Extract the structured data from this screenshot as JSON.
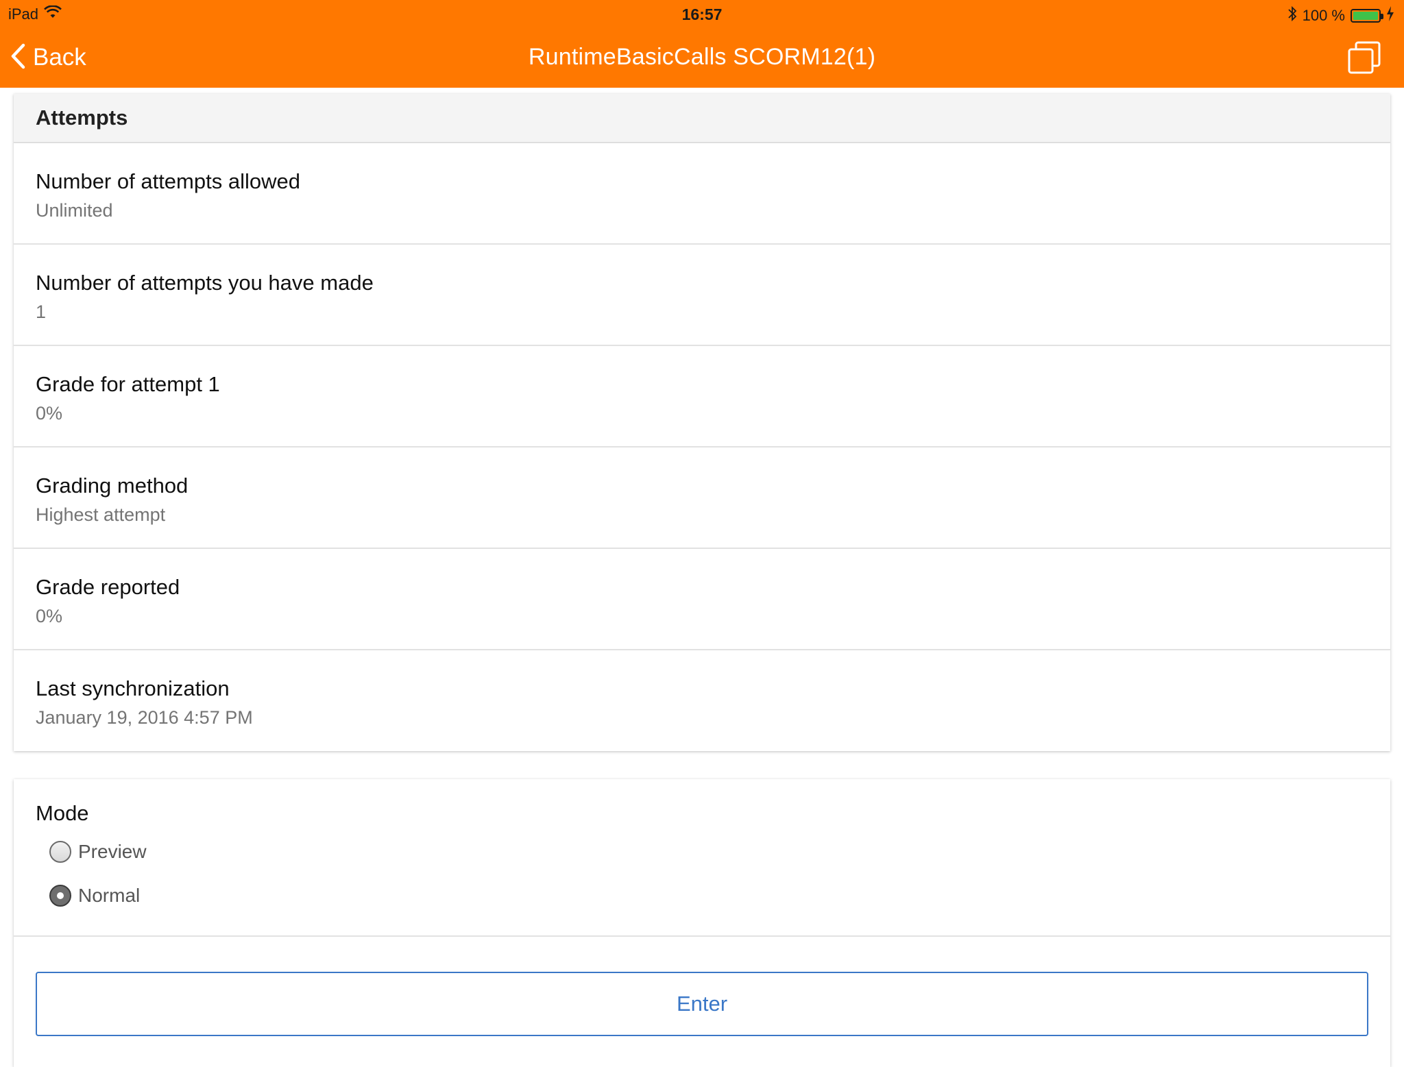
{
  "status_bar": {
    "device": "iPad",
    "time": "16:57",
    "battery_text": "100 %",
    "battery_level": 1.0,
    "icons": [
      "wifi-icon",
      "bluetooth-icon",
      "battery-icon",
      "charging-bolt-icon"
    ]
  },
  "nav": {
    "back_label": "Back",
    "title": "RuntimeBasicCalls SCORM12(1)",
    "back_icon": "chevron-left-icon",
    "windows_icon": "windows-icon"
  },
  "colors": {
    "header": "#ff7800",
    "accent": "#3a77c7",
    "value_text": "#747474"
  },
  "attempts": {
    "header": "Attempts",
    "rows": [
      {
        "label": "Number of attempts allowed",
        "value": "Unlimited"
      },
      {
        "label": "Number of attempts you have made",
        "value": "1"
      },
      {
        "label": "Grade for attempt 1",
        "value": "0%"
      },
      {
        "label": "Grading method",
        "value": "Highest attempt"
      },
      {
        "label": "Grade reported",
        "value": "0%"
      },
      {
        "label": "Last synchronization",
        "value": "January 19, 2016 4:57 PM"
      }
    ]
  },
  "mode": {
    "title": "Mode",
    "options": [
      {
        "label": "Preview",
        "checked": false
      },
      {
        "label": "Normal",
        "checked": true
      }
    ],
    "selected": "Normal"
  },
  "enter_button": {
    "label": "Enter"
  }
}
